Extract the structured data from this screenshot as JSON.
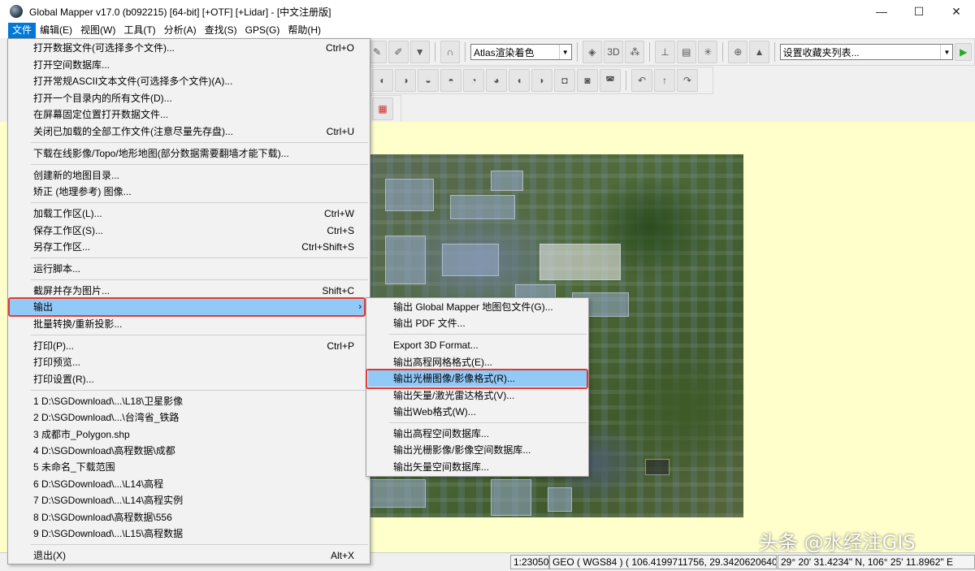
{
  "window": {
    "title": "Global Mapper v17.0 (b092215) [64-bit] [+OTF] [+Lidar] - [中文注册版]",
    "minimize": "—",
    "maximize": "☐",
    "close": "✕"
  },
  "menubar": [
    {
      "label": "文件"
    },
    {
      "label": "编辑(E)"
    },
    {
      "label": "视图(W)"
    },
    {
      "label": "工具(T)"
    },
    {
      "label": "分析(A)"
    },
    {
      "label": "查找(S)"
    },
    {
      "label": "GPS(G)"
    },
    {
      "label": "帮助(H)"
    }
  ],
  "toolbar": {
    "shader_combo": "Atlas渲染着色",
    "favorites_combo": "设置收藏夹列表..."
  },
  "file_menu": {
    "items": [
      {
        "label": "打开数据文件(可选择多个文件)...",
        "shortcut": "Ctrl+O"
      },
      {
        "label": "打开空间数据库...",
        "shortcut": ""
      },
      {
        "label": "打开常规ASCII文本文件(可选择多个文件)(A)...",
        "shortcut": ""
      },
      {
        "label": "打开一个目录内的所有文件(D)...",
        "shortcut": ""
      },
      {
        "label": "在屏幕固定位置打开数据文件...",
        "shortcut": ""
      },
      {
        "label": "关闭已加载的全部工作文件(注意尽量先存盘)...",
        "shortcut": "Ctrl+U"
      },
      {
        "label": "下载在线影像/Topo/地形地图(部分数据需要翻墙才能下载)...",
        "shortcut": ""
      },
      {
        "label": "创建新的地图目录...",
        "shortcut": ""
      },
      {
        "label": "矫正 (地理参考) 图像...",
        "shortcut": ""
      },
      {
        "label": "加载工作区(L)...",
        "shortcut": "Ctrl+W"
      },
      {
        "label": "保存工作区(S)...",
        "shortcut": "Ctrl+S"
      },
      {
        "label": "另存工作区...",
        "shortcut": "Ctrl+Shift+S"
      },
      {
        "label": "运行脚本...",
        "shortcut": ""
      },
      {
        "label": "截屏并存为图片...",
        "shortcut": "Shift+C"
      },
      {
        "label": "输出",
        "shortcut": "",
        "submenu": "›"
      },
      {
        "label": "批量转换/重新投影...",
        "shortcut": ""
      },
      {
        "label": "打印(P)...",
        "shortcut": "Ctrl+P"
      },
      {
        "label": "打印预览...",
        "shortcut": ""
      },
      {
        "label": "打印设置(R)...",
        "shortcut": ""
      },
      {
        "label": "1 D:\\SGDownload\\...\\L18\\卫星影像",
        "shortcut": ""
      },
      {
        "label": "2 D:\\SGDownload\\...\\台湾省_铁路",
        "shortcut": ""
      },
      {
        "label": "3 成都市_Polygon.shp",
        "shortcut": ""
      },
      {
        "label": "4 D:\\SGDownload\\高程数据\\成都",
        "shortcut": ""
      },
      {
        "label": "5 未命名_下载范围",
        "shortcut": ""
      },
      {
        "label": "6 D:\\SGDownload\\...\\L14\\高程",
        "shortcut": ""
      },
      {
        "label": "7 D:\\SGDownload\\...\\L14\\高程实例",
        "shortcut": ""
      },
      {
        "label": "8 D:\\SGDownload\\高程数据\\556",
        "shortcut": ""
      },
      {
        "label": "9 D:\\SGDownload\\...\\L15\\高程数据",
        "shortcut": ""
      },
      {
        "label": "退出(X)",
        "shortcut": "Alt+X"
      }
    ]
  },
  "export_menu": {
    "items": [
      {
        "label": "输出 Global Mapper 地图包文件(G)..."
      },
      {
        "label": "输出 PDF 文件..."
      },
      {
        "label": "Export 3D Format..."
      },
      {
        "label": "输出高程网格格式(E)..."
      },
      {
        "label": "输出光栅图像/影像格式(R)..."
      },
      {
        "label": "输出矢量/激光雷达格式(V)..."
      },
      {
        "label": "输出Web格式(W)..."
      },
      {
        "label": "输出高程空间数据库..."
      },
      {
        "label": "输出光栅影像/影像空间数据库..."
      },
      {
        "label": "输出矢量空间数据库..."
      }
    ]
  },
  "statusbar": {
    "scale": "1:23050",
    "projection": "GEO ( WGS84 ) ( 106.4199711756, 29.3420620640 )",
    "dms": "29° 20' 31.4234\" N, 106° 25' 11.8962\" E"
  },
  "watermark": "头条 @水经注GIS"
}
